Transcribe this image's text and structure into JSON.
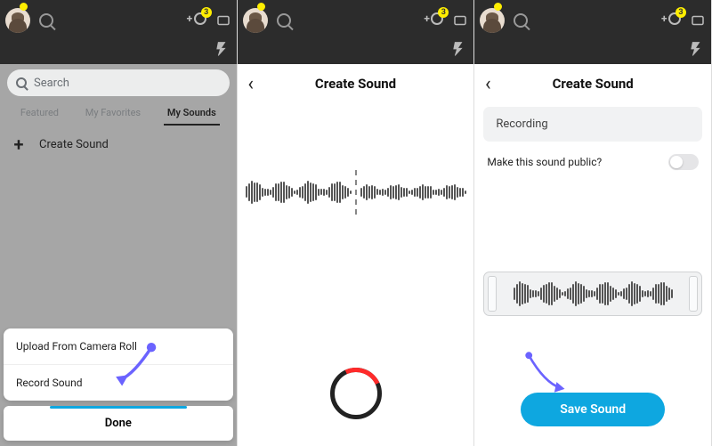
{
  "topbar": {
    "friend_badge": "3"
  },
  "panel1": {
    "search_placeholder": "Search",
    "tabs": {
      "featured": "Featured",
      "favorites": "My Favorites",
      "sounds": "My Sounds"
    },
    "create_label": "Create Sound",
    "sheet": {
      "upload": "Upload From Camera Roll",
      "record": "Record Sound"
    },
    "done": "Done"
  },
  "panel2": {
    "title": "Create Sound"
  },
  "panel3": {
    "title": "Create Sound",
    "recording_label": "Recording",
    "public_label": "Make this sound public?",
    "save": "Save Sound"
  }
}
